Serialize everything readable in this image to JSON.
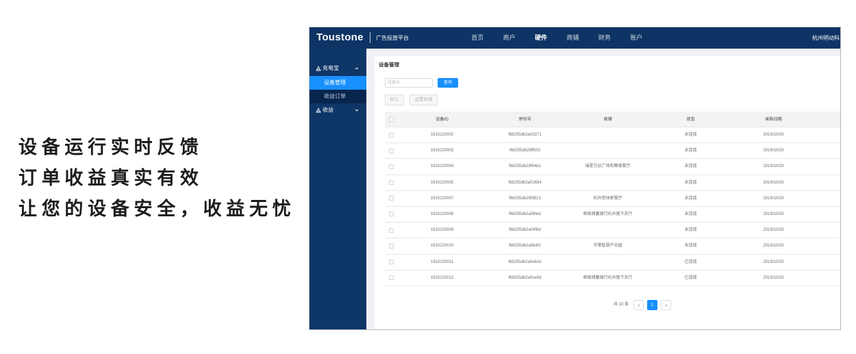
{
  "headline": {
    "lines": [
      "设备运行实时反馈",
      "订单收益真实有效",
      "让您的设备安全，收益无忧"
    ]
  },
  "topbar": {
    "logo": "Toustone",
    "platform_name": "广告投放平台",
    "nav": [
      {
        "label": "首页",
        "active": false
      },
      {
        "label": "商户",
        "active": false
      },
      {
        "label": "硬件",
        "active": true
      },
      {
        "label": "商铺",
        "active": false
      },
      {
        "label": "财务",
        "active": false
      },
      {
        "label": "账户",
        "active": false
      }
    ],
    "company": "杭州明动科"
  },
  "sidebar": {
    "groups": [
      {
        "label": "充电宝",
        "icon": "power-bank-icon",
        "expanded": true,
        "toggle_icon": "chevron-up-icon",
        "items": [
          {
            "label": "设备管理",
            "active": true
          },
          {
            "label": "收益订单",
            "active": false
          }
        ]
      },
      {
        "label": "收益",
        "icon": "income-icon",
        "expanded": false,
        "toggle_icon": "chevron-down-icon",
        "items": []
      }
    ]
  },
  "page": {
    "title": "设备管理",
    "search": {
      "placeholder": "设备ID",
      "value": ""
    },
    "query_label": "查询",
    "actions": {
      "transfer_label": "转让",
      "set_shop_label": "设置商铺",
      "disabled": true
    },
    "table": {
      "columns": {
        "device_id": "设备ID",
        "serial": "序列号",
        "shop": "商铺",
        "status": "状态",
        "date": "采购日期"
      },
      "rows": [
        {
          "device_id": "1910220002",
          "serial": "f68255db2a03371",
          "shop": "",
          "status": "未连接",
          "date": "2019/10/29"
        },
        {
          "device_id": "1910220003",
          "serial": "f68255db29ff533",
          "shop": "",
          "status": "未连接",
          "date": "2019/10/29"
        },
        {
          "device_id": "1910220004",
          "serial": "f68255db29f64d1",
          "shop": "瑞星万达广场和聚缘餐厅",
          "status": "未连接",
          "date": "2019/10/29"
        },
        {
          "device_id": "1910220005",
          "serial": "f68255db2a01654",
          "shop": "",
          "status": "未连接",
          "date": "2019/10/29"
        },
        {
          "device_id": "1910220007",
          "serial": "f68255db29fd513",
          "shop": "杭州老体家餐厅",
          "status": "未连接",
          "date": "2019/10/29"
        },
        {
          "device_id": "1910220008",
          "serial": "f68255db2a06fed",
          "shop": "邮政储蓄银行杭州留下支行",
          "status": "未连接",
          "date": "2019/10/29"
        },
        {
          "device_id": "1910220009",
          "serial": "f68255db2a04f6d",
          "shop": "",
          "status": "未连接",
          "date": "2019/10/29"
        },
        {
          "device_id": "1910220010",
          "serial": "f68255db2a0b4f2",
          "shop": "华策智慧产业园",
          "status": "未连接",
          "date": "2019/10/29"
        },
        {
          "device_id": "1910220011",
          "serial": "f68255db2a0eb2e",
          "shop": "",
          "status": "已连接",
          "date": "2019/10/29"
        },
        {
          "device_id": "1910220012",
          "serial": "f68255db2a0ce0d",
          "shop": "邮政储蓄银行杭州留下支行",
          "status": "已连接",
          "date": "2019/10/29"
        }
      ]
    },
    "pagination": {
      "total_text": "共 10 条",
      "current_page": "1",
      "prev_icon": "chevron-left-icon",
      "next_icon": "chevron-right-icon"
    }
  },
  "colors": {
    "topbar": "#0d3464",
    "sidebar": "#0e3667",
    "submenu": "#07254d",
    "accent": "#1890ff",
    "page_bg": "#f0f2f5"
  }
}
